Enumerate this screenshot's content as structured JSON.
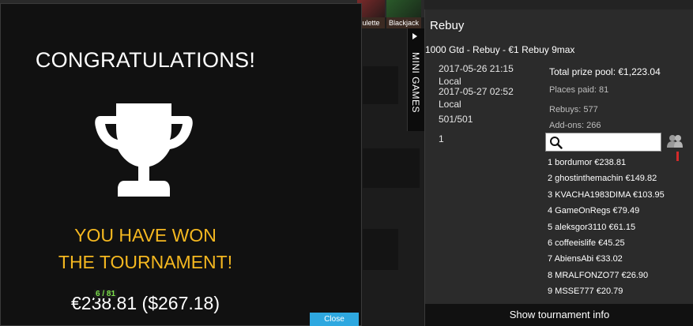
{
  "background": {
    "games": [
      {
        "label": "ulette",
        "icon": "roulette-icon"
      },
      {
        "label": "Blackjack",
        "icon": "blackjack-icon"
      }
    ],
    "mini_games_label": "MINI GAMES"
  },
  "modal": {
    "title": "CONGRATULATIONS!",
    "won_line1": "YOU HAVE WON",
    "won_line2": "THE TOURNAMENT!",
    "prize": "€238.81 ($267.18)",
    "seat_badge": "6 / 81",
    "close_label": "Close",
    "colors": {
      "accent": "#f5b820",
      "button": "#2ea8e0"
    }
  },
  "panel": {
    "title": "Rebuy",
    "subtitle": "1000 Gtd - Rebuy - €1 Rebuy 9max",
    "start_time": "2017-05-26 21:15",
    "start_zone": "Local",
    "end_time": "2017-05-27 02:52",
    "end_zone": "Local",
    "entries": "501/501",
    "position": "1",
    "total_prize_pool": "Total prize pool: €1,223.04",
    "places_paid": "Places paid: 81",
    "rebuys": "Rebuys: 577",
    "addons": "Add-ons: 266",
    "search_value": "",
    "leaderboard": [
      "1 bordumor €238.81",
      "2 ghostinthemachin €149.82",
      "3 KVACHA1983DIMA €103.95",
      "4 GameOnRegs €79.49",
      "5 aleksgor3110 €61.15",
      "6 coffeeislife €45.25",
      "7 AbiensAbi €33.02",
      "8 MRALFONZO77 €26.90",
      "9 MSSE777 €20.79"
    ],
    "show_info_label": "Show tournament info"
  }
}
